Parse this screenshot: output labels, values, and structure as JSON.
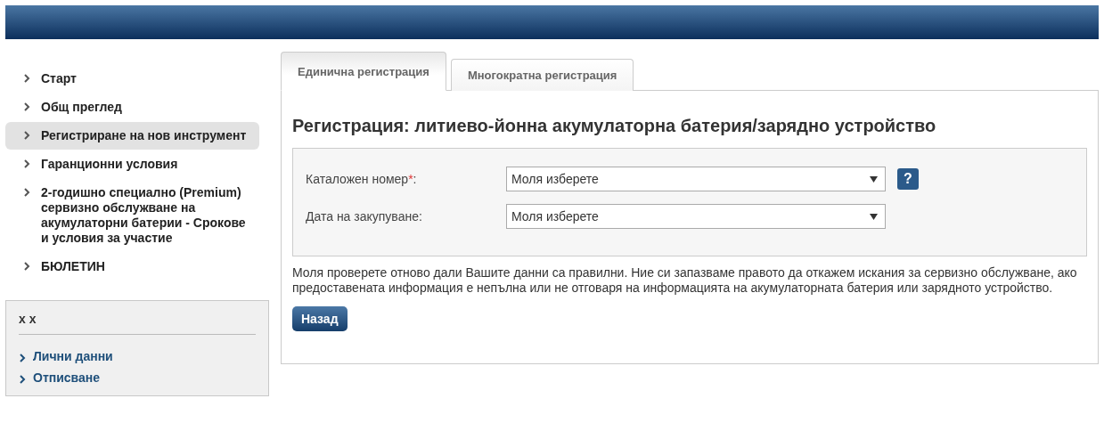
{
  "nav": [
    {
      "label": "Старт",
      "selected": false
    },
    {
      "label": "Общ преглед",
      "selected": false
    },
    {
      "label": "Регистриране на нов инструмент",
      "selected": true
    },
    {
      "label": "Гаранционни условия",
      "selected": false
    },
    {
      "label": "2-годишно специално (Premium) сервизно обслужване на акумулаторни батерии - Срокове и условия за участие",
      "selected": false
    },
    {
      "label": "БЮЛЕТИН",
      "selected": false
    }
  ],
  "account": {
    "title": "x x",
    "links": [
      "Лични данни",
      "Отписване"
    ]
  },
  "tabs": [
    {
      "label": "Единична регистрация",
      "selected": true
    },
    {
      "label": "Многократна регистрация",
      "selected": false
    }
  ],
  "heading": "Регистрация: литиево-йонна акумулаторна батерия/зарядно устройство",
  "fields": [
    {
      "label": "Каталожен номер",
      "marker": "*",
      "suffix": ":",
      "value": "Моля изберете",
      "help": "?"
    },
    {
      "label": "Дата на закупуване:",
      "value": "Моля изберете"
    }
  ],
  "notice": "Моля проверете отново дали Вашите данни са правилни. Ние си запазваме правото да откажем искания за сервизно обслужване, ако предоставената информация е непълна или не отговаря на информацията на акумулаторната батерия или зарядното устройство.",
  "back_button": "Назад"
}
